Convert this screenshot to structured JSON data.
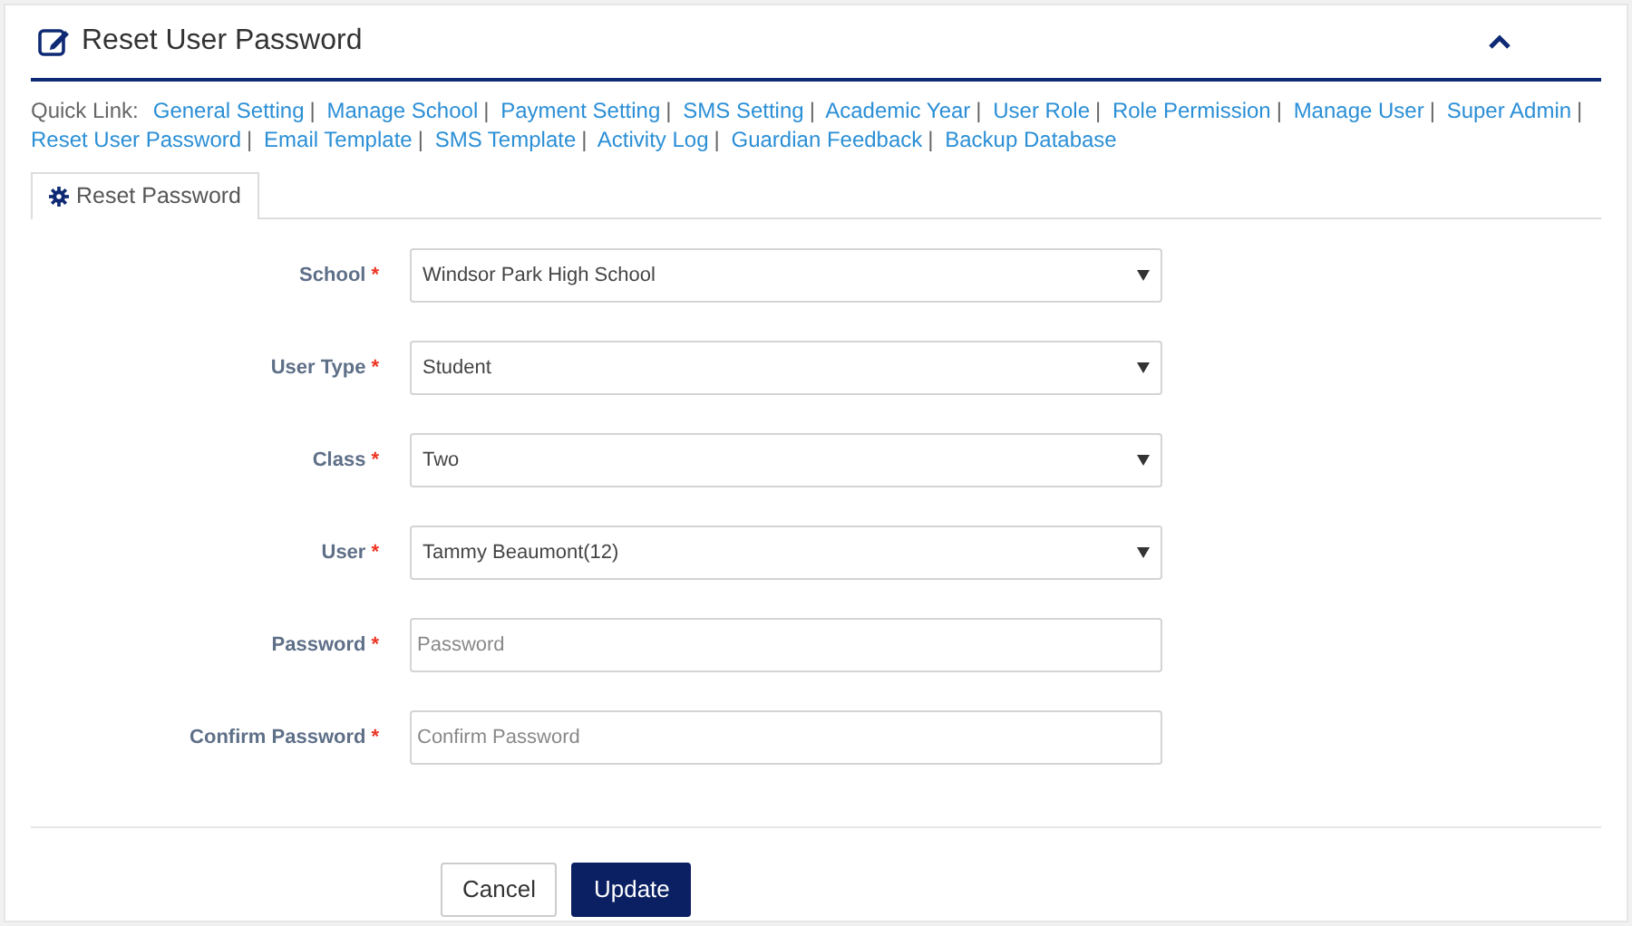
{
  "panel": {
    "title": "Reset User Password",
    "collapsed": false
  },
  "quick_links": {
    "label": "Quick Link:",
    "links": [
      {
        "text": "General Setting",
        "separator": "|"
      },
      {
        "text": "Manage School",
        "separator": "|"
      },
      {
        "text": "Payment Setting",
        "separator": "|"
      },
      {
        "text": "SMS Setting",
        "separator": "|"
      },
      {
        "text": "Academic Year",
        "separator": "|"
      },
      {
        "text": "User Role",
        "separator": "|"
      },
      {
        "text": "Role Permission",
        "separator": "|"
      },
      {
        "text": "Manage User",
        "separator": "|"
      },
      {
        "text": "Super Admin",
        "separator": "|"
      },
      {
        "text": "Reset User Password",
        "separator": "|"
      },
      {
        "text": "Email Template",
        "separator": "|"
      },
      {
        "text": "SMS Template",
        "separator": "|"
      },
      {
        "text": "Activity Log",
        "separator": "|"
      },
      {
        "text": "Guardian Feedback",
        "separator": "|"
      },
      {
        "text": "Backup Database"
      }
    ]
  },
  "tabs": [
    {
      "label": "Reset Password",
      "selected": true
    }
  ],
  "fields": [
    {
      "kind": "select",
      "label": "School",
      "required_mark": "*",
      "value": "Windsor Park High School"
    },
    {
      "kind": "select",
      "label": "User Type",
      "required_mark": "*",
      "value": "Student"
    },
    {
      "kind": "select",
      "label": "Class",
      "required_mark": "*",
      "value": "Two"
    },
    {
      "kind": "select",
      "label": "User",
      "required_mark": "*",
      "value": "Tammy Beaumont(12)"
    },
    {
      "kind": "input",
      "label": "Password",
      "required_mark": "*",
      "placeholder": "Password"
    },
    {
      "kind": "input",
      "label": "Confirm Password",
      "required_mark": "*",
      "placeholder": "Confirm Password"
    }
  ],
  "buttons": [
    {
      "kind": "secondary",
      "label": "Cancel"
    },
    {
      "kind": "primary",
      "label": "Update"
    }
  ]
}
